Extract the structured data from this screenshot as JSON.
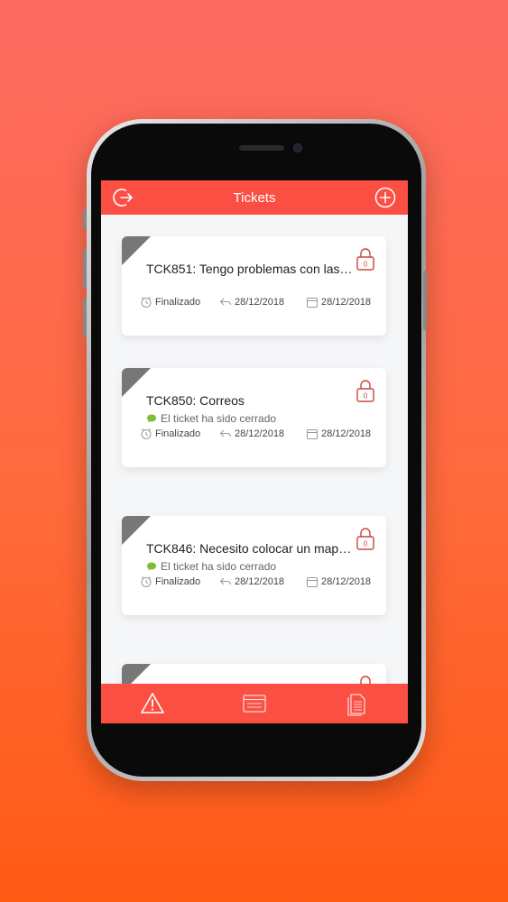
{
  "header": {
    "title": "Tickets",
    "left_icon": "logout-icon",
    "right_icon": "plus-circle-icon"
  },
  "tickets": [
    {
      "title": "TCK851: Tengo problemas con las…",
      "message": "",
      "status": "Finalizado",
      "reply_date": "28/12/2018",
      "created_date": "28/12/2018",
      "lock_count": "0"
    },
    {
      "title": "TCK850: Correos",
      "message": "El ticket ha sido cerrado",
      "status": "Finalizado",
      "reply_date": "28/12/2018",
      "created_date": "28/12/2018",
      "lock_count": "0"
    },
    {
      "title": "TCK846: Necesito colocar un map…",
      "message": "El ticket ha sido cerrado",
      "status": "Finalizado",
      "reply_date": "28/12/2018",
      "created_date": "28/12/2018",
      "lock_count": "0"
    }
  ],
  "bottom_tabs": [
    {
      "icon": "warning-icon"
    },
    {
      "icon": "browser-window-icon"
    },
    {
      "icon": "document-icon"
    }
  ],
  "colors": {
    "accent": "#fb4f43",
    "lock": "#c9463d",
    "message_dot": "#7cbf3a",
    "corner": "#777777"
  }
}
